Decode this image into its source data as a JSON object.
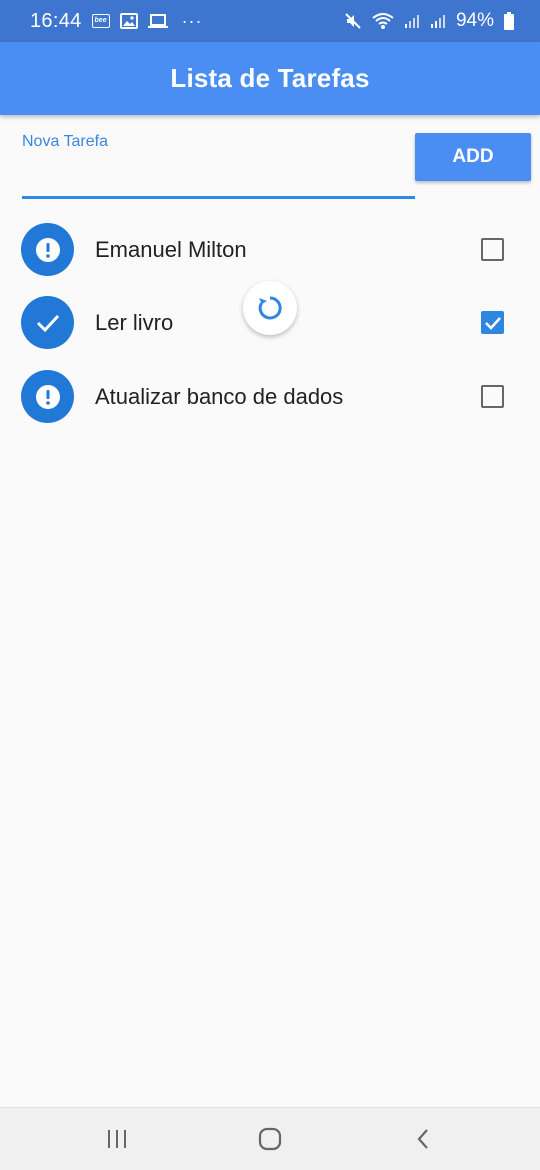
{
  "status_bar": {
    "time": "16:44",
    "battery": "94%",
    "more": "···",
    "left_icons": [
      "bee-icon",
      "image-icon",
      "laptop-icon",
      "more-dots-icon"
    ],
    "right_icons": [
      "mute-icon",
      "wifi-icon",
      "signal-icon",
      "signal-icon",
      "battery-icon"
    ]
  },
  "app_bar": {
    "title": "Lista de Tarefas",
    "color": "#4a8ef4"
  },
  "new_task": {
    "label": "Nova Tarefa",
    "value": "",
    "add_button": "ADD"
  },
  "tasks": [
    {
      "label": "Emanuel Milton",
      "checked": false,
      "icon": "alert-icon"
    },
    {
      "label": "Ler livro",
      "checked": true,
      "icon": "check-icon"
    },
    {
      "label": "Atualizar banco de dados",
      "checked": false,
      "icon": "alert-icon"
    }
  ],
  "refresh_indicator": {
    "icon": "refresh-icon"
  },
  "nav_bar": {
    "buttons": [
      "recent-apps-icon",
      "home-icon",
      "back-icon"
    ]
  },
  "colors": {
    "status_bar": "#3e76cf",
    "accent": "#4a8ef4",
    "avatar": "#2278d6",
    "checkbox_checked": "#2f86e0",
    "underline": "#2f8ae3"
  }
}
